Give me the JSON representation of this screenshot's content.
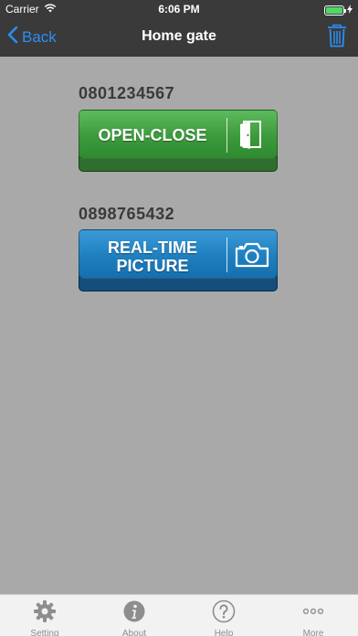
{
  "status_bar": {
    "carrier": "Carrier",
    "time": "6:06 PM",
    "battery_level": 1.0
  },
  "nav": {
    "back_label": "Back",
    "title": "Home gate",
    "back_icon": "chevron-left-icon",
    "trash_icon": "trash-icon",
    "accent_color": "#2b8ef5"
  },
  "devices": [
    {
      "number": "0801234567",
      "button_label": "OPEN-CLOSE",
      "icon": "door-icon",
      "color": "#3c9a3c"
    },
    {
      "number": "0898765432",
      "button_label_line1": "REAL-TIME",
      "button_label_line2": "PICTURE",
      "icon": "camera-icon",
      "color": "#1f7fbf"
    }
  ],
  "tabs": [
    {
      "label": "Setting",
      "icon": "gear-icon"
    },
    {
      "label": "About",
      "icon": "info-icon"
    },
    {
      "label": "Help",
      "icon": "help-icon"
    },
    {
      "label": "More",
      "icon": "more-icon"
    }
  ]
}
